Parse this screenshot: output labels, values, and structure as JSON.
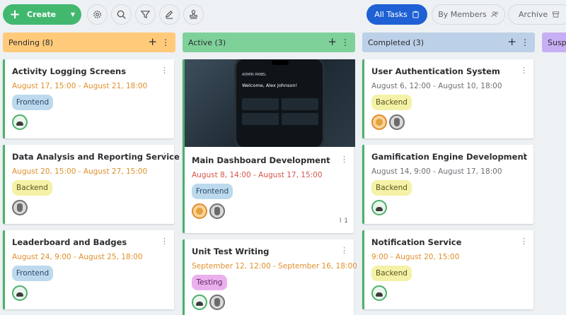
{
  "toolbar": {
    "create_label": "Create",
    "icons": [
      "gear-icon",
      "search-icon",
      "filter-icon",
      "edit-icon",
      "stamp-icon"
    ],
    "views": {
      "all_tasks": "All Tasks",
      "by_members": "By Members",
      "archive": "Archive"
    }
  },
  "colors": {
    "create": "#42b86f",
    "active_view": "#1f61d4",
    "pending": "#ffca7a",
    "active": "#7fd19a",
    "completed": "#bcd0e8",
    "suspended": "#c8aef2"
  },
  "columns": {
    "pending": {
      "title": "Pending (8)",
      "cards": [
        {
          "title": "Activity Logging Screens",
          "date": "August 17, 15:00 - August 21, 18:00",
          "tag": "Frontend"
        },
        {
          "title": "Data Analysis and Reporting Service",
          "date": "August 20, 15:00 - August 27, 15:00",
          "tag": "Backend"
        },
        {
          "title": "Leaderboard and Badges",
          "date": "August 24, 9:00 - August 25, 18:00",
          "tag": "Frontend"
        }
      ]
    },
    "active": {
      "title": "Active (3)",
      "cards": [
        {
          "title": "Main Dashboard Development",
          "date": "August 8, 14:00 - August 17, 15:00",
          "tag": "Frontend",
          "attachments": "1",
          "image": {
            "panel": "ADMIN PANEL",
            "welcome": "Welcome, Alex Johnson!"
          }
        },
        {
          "title": "Unit Test Writing",
          "date": "September 12, 12:00 - September 16, 18:00",
          "tag": "Testing"
        }
      ]
    },
    "completed": {
      "title": "Completed (3)",
      "cards": [
        {
          "title": "User Authentication System",
          "date": "August 6, 12:00 - August 10, 18:00",
          "tag": "Backend"
        },
        {
          "title": "Gamification Engine Development",
          "date": "August 14, 9:00 - August 17, 18:00",
          "tag": "Backend"
        },
        {
          "title": "Notification Service",
          "date": "9:00 - August 20, 15:00",
          "tag": "Backend"
        }
      ]
    },
    "suspended": {
      "title": "Susp"
    }
  }
}
